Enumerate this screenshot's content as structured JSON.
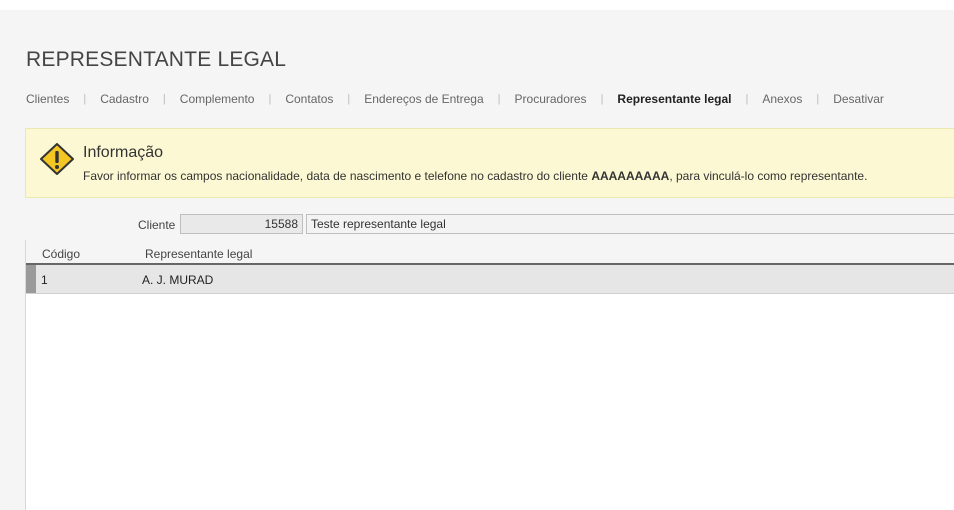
{
  "page": {
    "title": "REPRESENTANTE LEGAL"
  },
  "tabs": [
    {
      "label": "Clientes",
      "active": false
    },
    {
      "label": "Cadastro",
      "active": false
    },
    {
      "label": "Complemento",
      "active": false
    },
    {
      "label": "Contatos",
      "active": false
    },
    {
      "label": "Endereços de Entrega",
      "active": false
    },
    {
      "label": "Procuradores",
      "active": false
    },
    {
      "label": "Representante legal",
      "active": true
    },
    {
      "label": "Anexos",
      "active": false
    },
    {
      "label": "Desativar",
      "active": false
    }
  ],
  "info": {
    "icon": "warning-icon",
    "title": "Informação",
    "message_before": "Favor informar os campos nacionalidade, data de nascimento e telefone no cadastro do cliente ",
    "message_bold": "AAAAAAAAA",
    "message_after": ", para vinculá-lo como representante.",
    "background": "#fbf8d3"
  },
  "cliente": {
    "label": "Cliente",
    "code": "15588",
    "name": "Teste representante legal"
  },
  "grid": {
    "columns": [
      "Código",
      "Representante legal"
    ],
    "rows": [
      {
        "code": "1",
        "name": "A. J. MURAD"
      }
    ]
  }
}
